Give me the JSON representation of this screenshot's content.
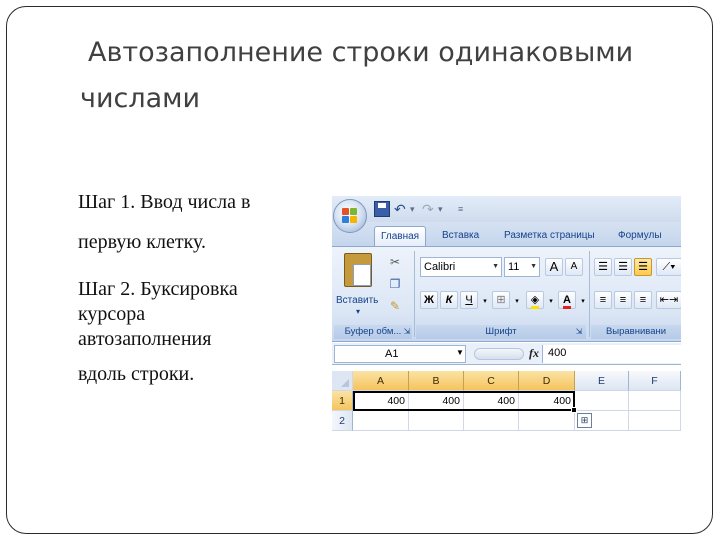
{
  "slide": {
    "title": "Автозаполнение строки одинаковыми числами",
    "step1_line1": "Шаг 1. Ввод числа в",
    "step1_line2": "первую клетку.",
    "step2_line1": "Шаг 2. Буксировка",
    "step2_line2": "курсора",
    "step2_line3": "автозаполнения",
    "step2_line4": "вдоль строки."
  },
  "excel": {
    "tabs": [
      "Главная",
      "Вставка",
      "Разметка страницы",
      "Формулы"
    ],
    "active_tab": "Главная",
    "clipboard": {
      "paste_label": "Вставить",
      "group_label": "Буфер обм..."
    },
    "font": {
      "name": "Calibri",
      "size": "11",
      "group_label": "Шрифт",
      "bold": "Ж",
      "italic": "К",
      "underline": "Ч",
      "grow": "A",
      "shrink": "A"
    },
    "alignment": {
      "group_label": "Выравнивани"
    },
    "name_box": "A1",
    "fx_label": "fx",
    "formula_value": "400",
    "columns": [
      "A",
      "B",
      "C",
      "D",
      "E",
      "F"
    ],
    "rows": [
      {
        "header": "1",
        "cells": [
          "400",
          "400",
          "400",
          "400",
          "",
          ""
        ]
      },
      {
        "header": "2",
        "cells": [
          "",
          "",
          "",
          "",
          "",
          ""
        ]
      }
    ],
    "colors": {
      "accent_selected": "#f5c45e",
      "ribbon": "#dbe6f5",
      "tab_text": "#15428b"
    }
  }
}
